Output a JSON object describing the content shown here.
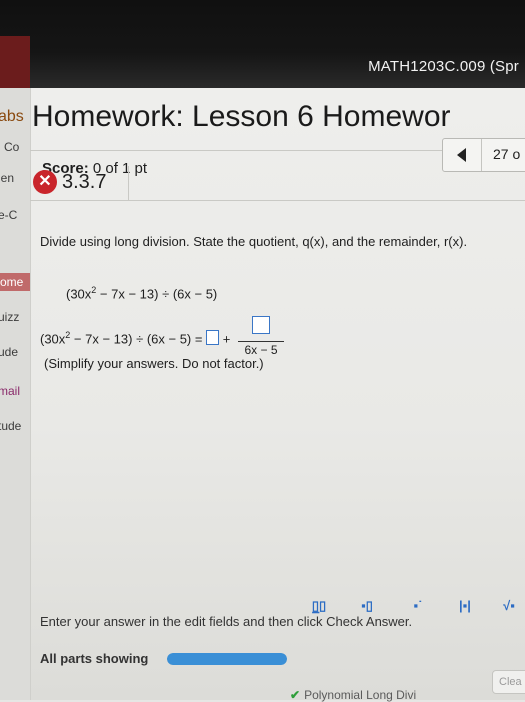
{
  "header": {
    "course": "MATH1203C.009 (Spr"
  },
  "sidebar": {
    "items": [
      {
        "label": "abs"
      },
      {
        "label": "Co"
      },
      {
        "label": "len"
      },
      {
        "label": "e-C"
      },
      {
        "label": "ome"
      },
      {
        "label": "uizz"
      },
      {
        "label": "ude"
      },
      {
        "label": "mail"
      },
      {
        "label": "tude"
      }
    ]
  },
  "homework": {
    "title": "Homework: Lesson 6 Homewor",
    "score_label": "Score:",
    "score_value": "0 of 1 pt",
    "question_count": "27 o",
    "question_number": "3.3.7"
  },
  "question": {
    "instruction": "Divide using long division. State the quotient, q(x), and the remainder, r(x).",
    "problem_pre": "(30x",
    "problem_exp": "2",
    "problem_post": " − 7x − 13) ÷ (6x − 5)",
    "answer_pre": "(30x",
    "answer_exp": "2",
    "answer_mid": " − 7x − 13) ÷ (6x − 5) =",
    "plus": "+",
    "denominator": "6x − 5",
    "simplify_note": "(Simplify your answers. Do not factor.)"
  },
  "footer": {
    "enter_hint": "Enter your answer in the edit fields and then click Check Answer.",
    "all_parts": "All parts showing",
    "progress": 1.0,
    "clear_label": "Clea",
    "bottom_link": "Polynomial Long Divi"
  },
  "colors": {
    "accent": "#3a76c6",
    "error": "#c9252b",
    "progress": "#3a8fd6"
  }
}
